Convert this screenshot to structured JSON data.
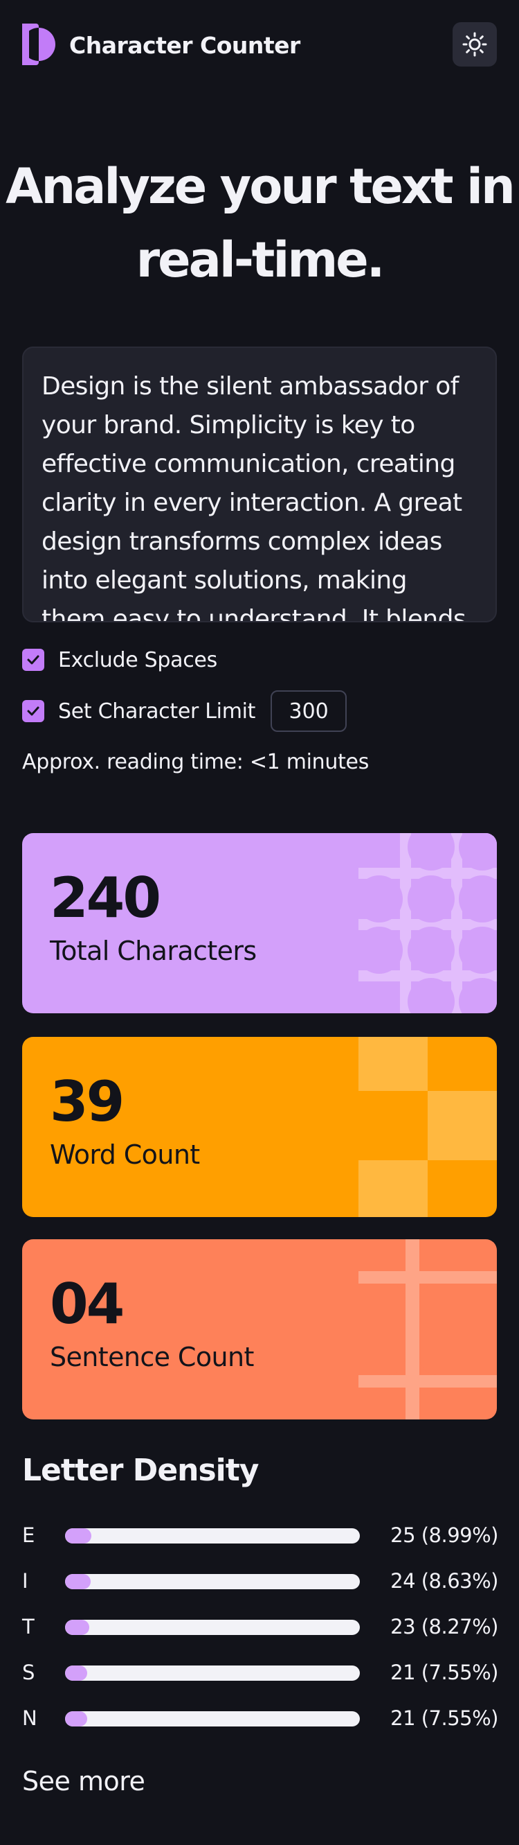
{
  "header": {
    "app_title": "Character Counter",
    "logo_icon": "half-circle-logo-icon",
    "theme_toggle_icon": "sun-icon"
  },
  "hero": {
    "line1": "Analyze your text in",
    "line2": "real-time."
  },
  "textarea": {
    "value": "Design is the silent ambassador of your brand. Simplicity is key to effective communication, creating clarity in every interaction. A great design transforms complex ideas into elegant solutions, making them easy to understand. It blends"
  },
  "options": {
    "exclude_spaces": {
      "label": "Exclude Spaces",
      "checked": true
    },
    "char_limit": {
      "label": "Set Character Limit",
      "checked": true,
      "value": "300"
    },
    "reading_time": "Approx. reading time: <1 minutes"
  },
  "stats": [
    {
      "value": "240",
      "label": "Total Characters",
      "color": "#D3A0FA"
    },
    {
      "value": "39",
      "label": "Word Count",
      "color": "#FF9F00"
    },
    {
      "value": "04",
      "label": "Sentence Count",
      "color": "#FE8159"
    }
  ],
  "density": {
    "title": "Letter Density",
    "items": [
      {
        "letter": "E",
        "count": 25,
        "percent": 8.99,
        "stat": "25 (8.99%)"
      },
      {
        "letter": "I",
        "count": 24,
        "percent": 8.63,
        "stat": "24 (8.63%)"
      },
      {
        "letter": "T",
        "count": 23,
        "percent": 8.27,
        "stat": "23 (8.27%)"
      },
      {
        "letter": "S",
        "count": 21,
        "percent": 7.55,
        "stat": "21 (7.55%)"
      },
      {
        "letter": "N",
        "count": 21,
        "percent": 7.55,
        "stat": "21 (7.55%)"
      }
    ],
    "see_more": "See more"
  },
  "colors": {
    "background": "#12131A",
    "accent": "#C27CF8",
    "density_bar": "#D3A0FA",
    "track": "#F2F2F7"
  }
}
